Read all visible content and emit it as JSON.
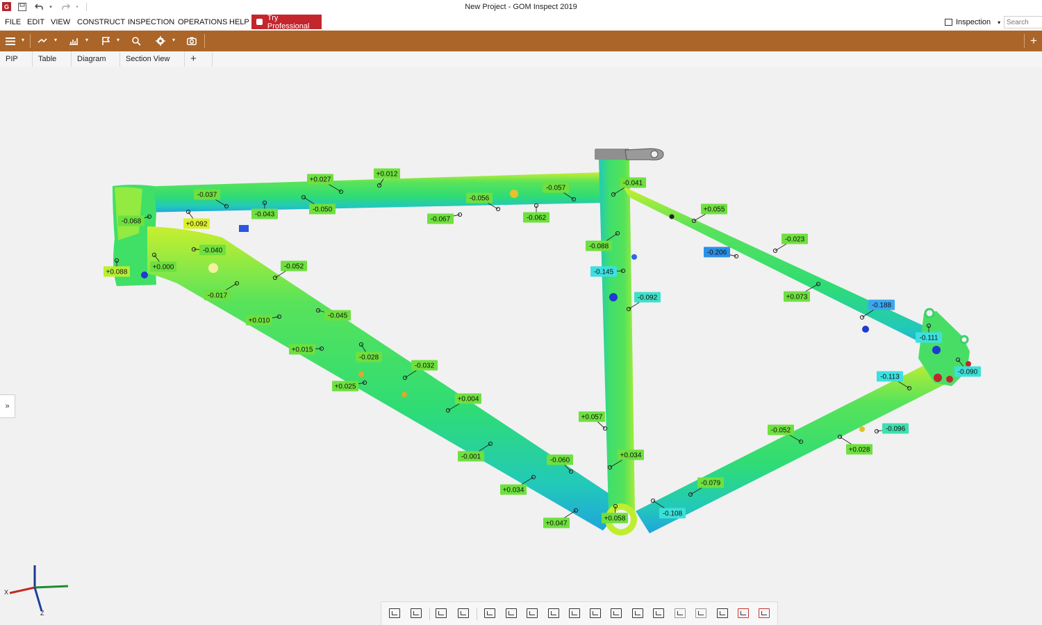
{
  "window": {
    "title": "New Project - GOM Inspect 2019"
  },
  "menu": [
    "FILE",
    "EDIT",
    "VIEW",
    "CONSTRUCT",
    "INSPECTION",
    "OPERATIONS",
    "HELP"
  ],
  "try_professional": "Try Professional",
  "workspace": {
    "label": "Inspection"
  },
  "search": {
    "placeholder": "Search"
  },
  "tabs": [
    "PIP",
    "Table",
    "Diagram",
    "Section View"
  ],
  "toolbar_add": "+",
  "expander": "»",
  "axis": {
    "x": "X",
    "z": "Z"
  },
  "deviation_labels": [
    {
      "text": "+0.027",
      "color": "#6ee03f"
    },
    {
      "text": "+0.012",
      "color": "#6ee03f"
    },
    {
      "text": "-0.037",
      "color": "#6ee03f"
    },
    {
      "text": "-0.043",
      "color": "#6ee03f"
    },
    {
      "text": "-0.050",
      "color": "#6ee03f"
    },
    {
      "text": "-0.056",
      "color": "#6ee03f"
    },
    {
      "text": "-0.067",
      "color": "#6ee03f"
    },
    {
      "text": "-0.057",
      "color": "#6ee03f"
    },
    {
      "text": "-0.062",
      "color": "#6ee03f"
    },
    {
      "text": "-0.041",
      "color": "#6ee03f"
    },
    {
      "text": "-0.068",
      "color": "#6ee03f"
    },
    {
      "text": "+0.092",
      "color": "#dcf02a"
    },
    {
      "text": "-0.040",
      "color": "#6ee03f"
    },
    {
      "text": "+0.088",
      "color": "#b9ee33"
    },
    {
      "text": "+0.000",
      "color": "#6ee03f"
    },
    {
      "text": "-0.052",
      "color": "#6ee03f"
    },
    {
      "text": "-0.017",
      "color": "#6ee03f"
    },
    {
      "text": "+0.010",
      "color": "#6ee03f"
    },
    {
      "text": "-0.045",
      "color": "#6ee03f"
    },
    {
      "text": "+0.015",
      "color": "#6ee03f"
    },
    {
      "text": "-0.028",
      "color": "#6ee03f"
    },
    {
      "text": "-0.032",
      "color": "#6ee03f"
    },
    {
      "text": "+0.025",
      "color": "#6ee03f"
    },
    {
      "text": "+0.004",
      "color": "#6ee03f"
    },
    {
      "text": "-0.001",
      "color": "#6ee03f"
    },
    {
      "text": "-0.060",
      "color": "#6ee03f"
    },
    {
      "text": "+0.034",
      "color": "#6ee03f"
    },
    {
      "text": "+0.047",
      "color": "#6ee03f"
    },
    {
      "text": "+0.058",
      "color": "#6ee03f"
    },
    {
      "text": "+0.057",
      "color": "#6ee03f"
    },
    {
      "text": "+0.034",
      "color": "#6ee03f"
    },
    {
      "text": "-0.088",
      "color": "#6ee03f"
    },
    {
      "text": "-0.145",
      "color": "#3de0e0"
    },
    {
      "text": "-0.092",
      "color": "#3de0c8"
    },
    {
      "text": "-0.206",
      "color": "#2a8fe8"
    },
    {
      "text": "+0.055",
      "color": "#6ee03f"
    },
    {
      "text": "-0.023",
      "color": "#6ee03f"
    },
    {
      "text": "+0.073",
      "color": "#6ee03f"
    },
    {
      "text": "-0.188",
      "color": "#3aa8f0"
    },
    {
      "text": "-0.111",
      "color": "#3de0e0"
    },
    {
      "text": "-0.090",
      "color": "#3de0d8"
    },
    {
      "text": "-0.113",
      "color": "#3de0e0"
    },
    {
      "text": "-0.052",
      "color": "#6ee03f"
    },
    {
      "text": "-0.096",
      "color": "#3de0b0"
    },
    {
      "text": "+0.028",
      "color": "#6ee03f"
    },
    {
      "text": "-0.079",
      "color": "#6ee03f"
    },
    {
      "text": "-0.108",
      "color": "#3de0d8"
    }
  ]
}
